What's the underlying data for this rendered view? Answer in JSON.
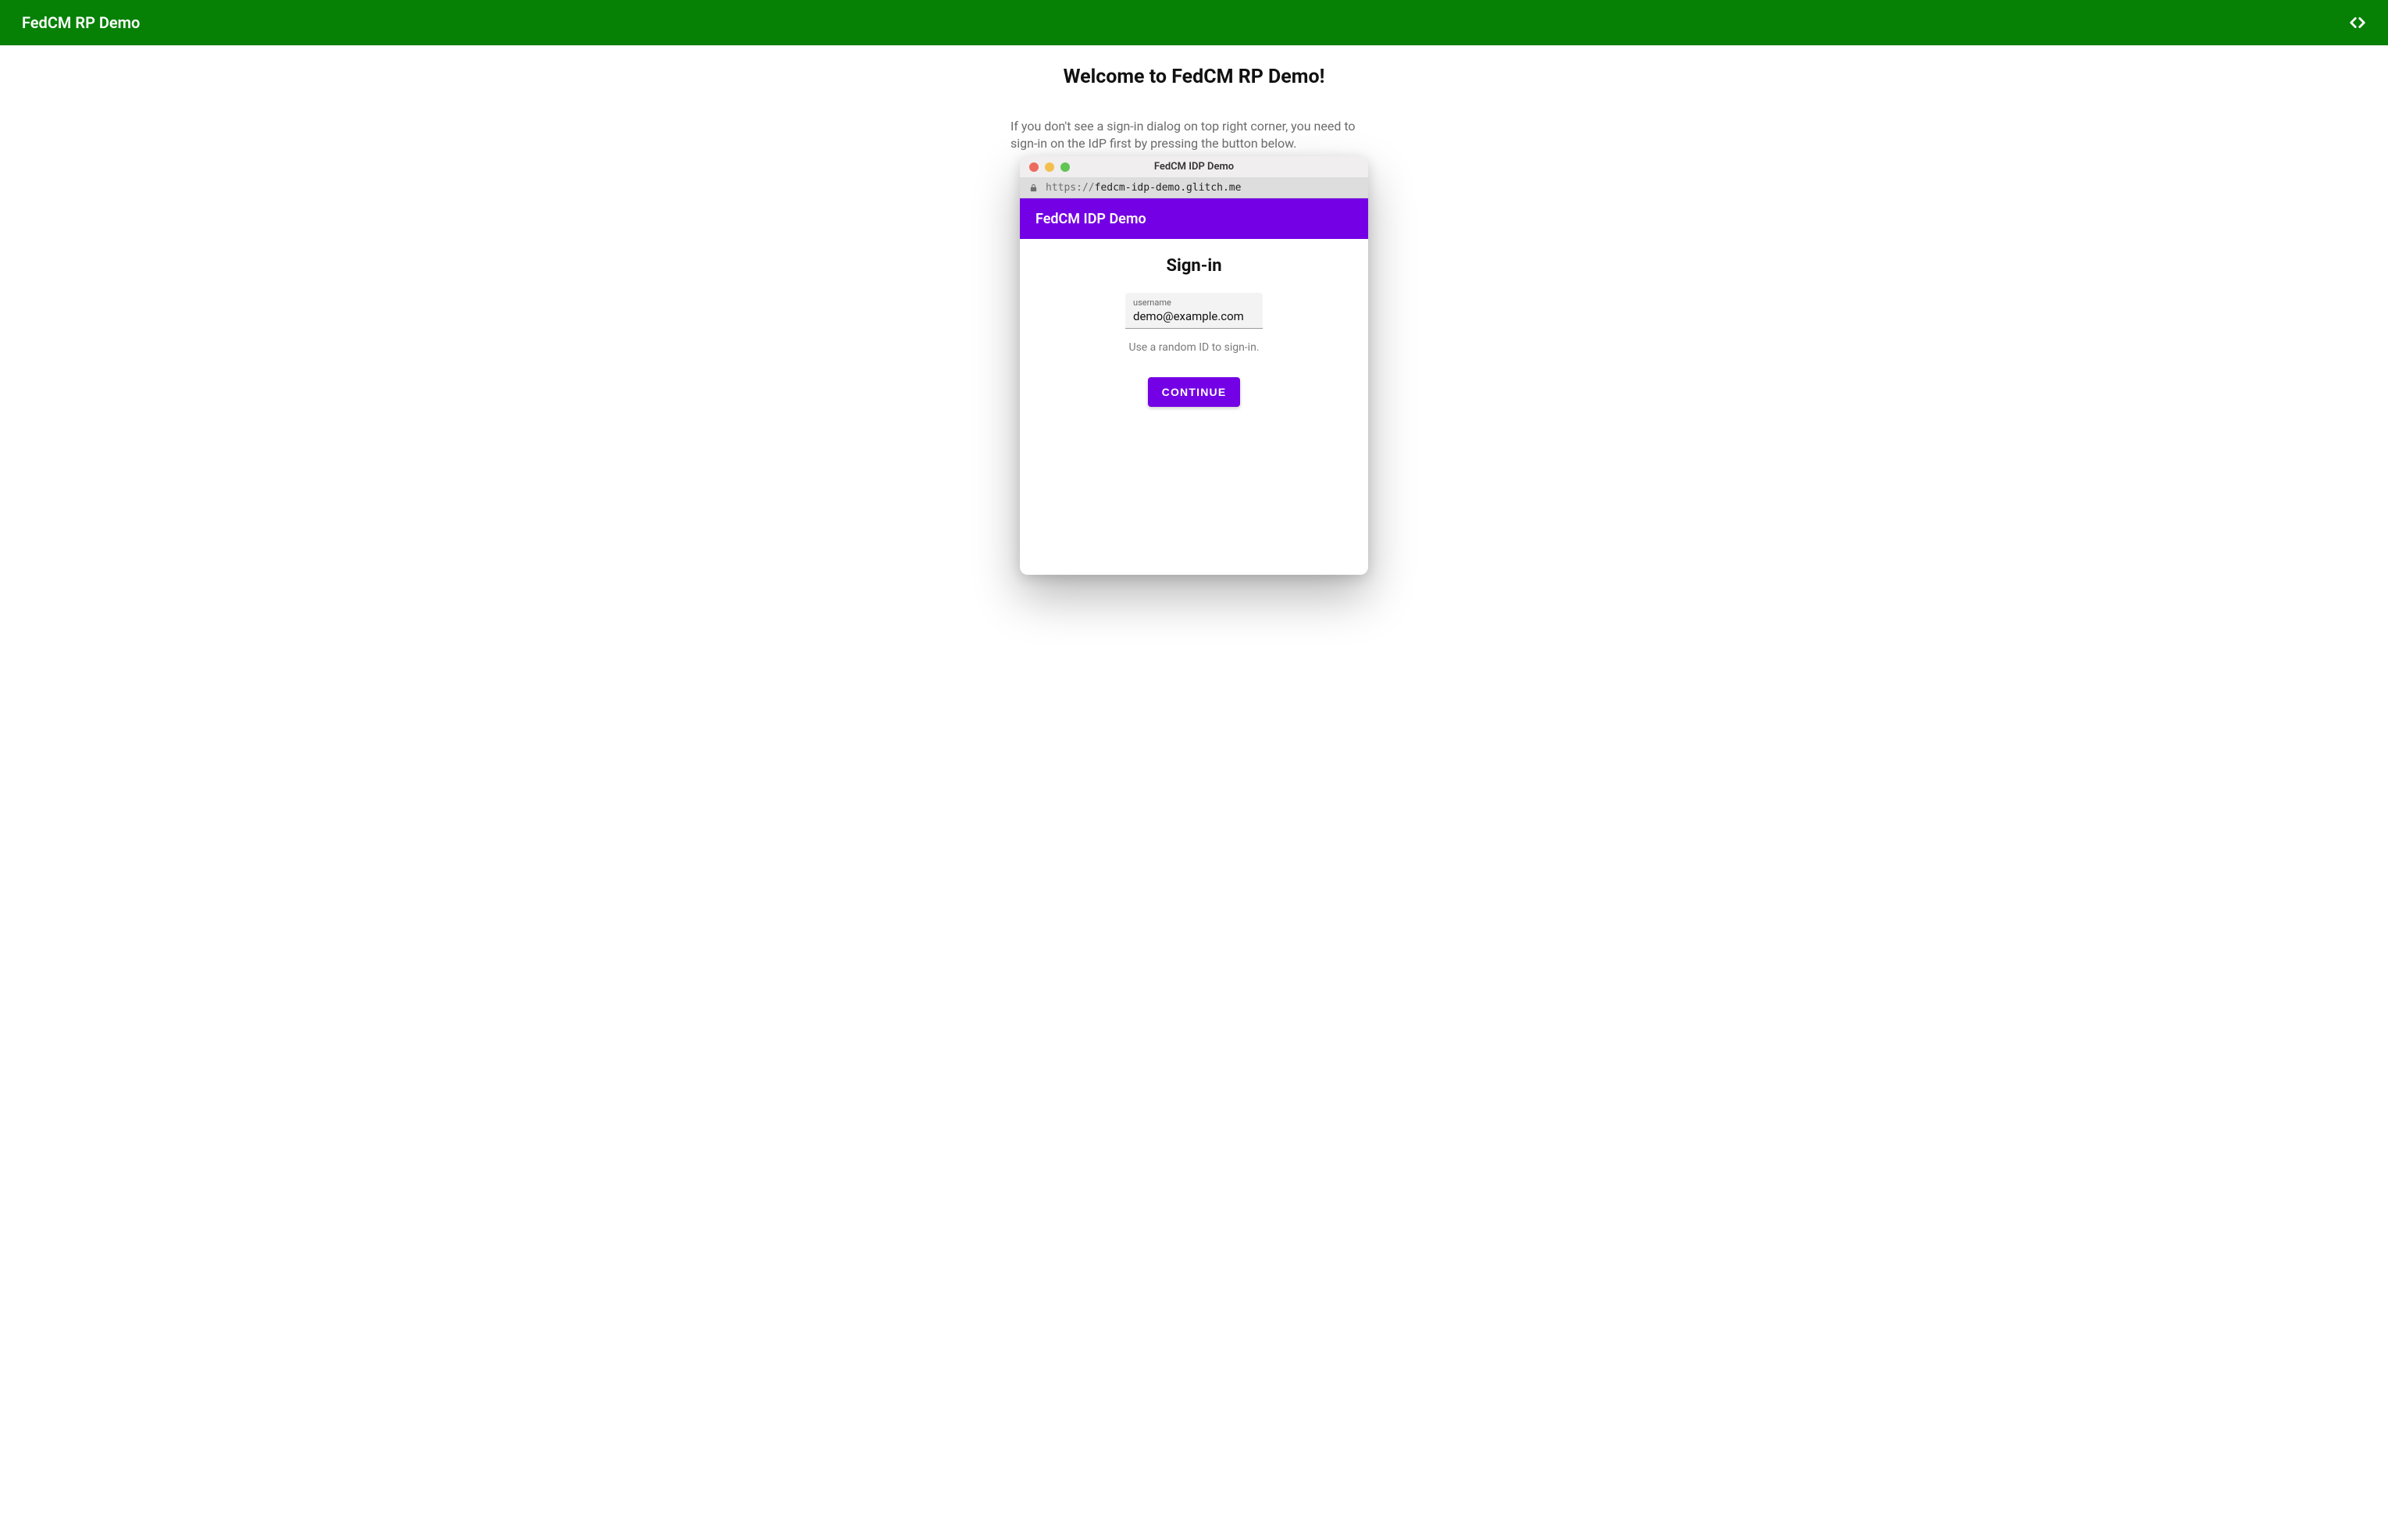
{
  "outer_header": {
    "title": "FedCM RP Demo"
  },
  "main": {
    "welcome_heading": "Welcome to FedCM RP Demo!",
    "intro_text": "If you don't see a sign-in dialog on top right corner, you need to sign-in on the IdP first by pressing the button below."
  },
  "popup": {
    "title": "FedCM IDP Demo",
    "url_prefix": "https://",
    "url_host": "fedcm-idp-demo.glitch.me",
    "idp_header_title": "FedCM IDP Demo",
    "signin_heading": "Sign-in",
    "username_label": "username",
    "username_value": "demo@example.com",
    "hint_text": "Use a random ID to sign-in.",
    "continue_label": "CONTINUE"
  },
  "colors": {
    "outer_brand": "#068106",
    "idp_brand": "#7400e5"
  }
}
